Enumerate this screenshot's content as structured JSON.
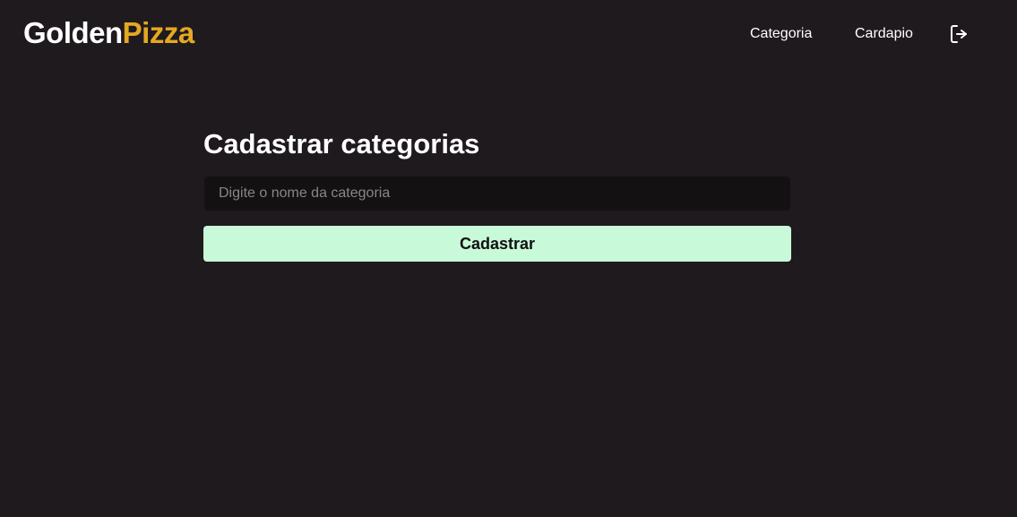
{
  "header": {
    "logo": {
      "part_1": "Golden",
      "part_2": "Pizza"
    },
    "nav": {
      "categoria": "Categoria",
      "cardapio": "Cardapio"
    },
    "logout_icon": "logout-icon"
  },
  "page": {
    "title": "Cadastrar categorias",
    "category_input": {
      "value": "",
      "placeholder": "Digite o nome da categoria"
    },
    "submit_label": "Cadastrar"
  },
  "colors": {
    "background": "#1f1a1d",
    "input_background": "#141113",
    "brand_accent": "#e5a823",
    "button_background": "#c8f9d8",
    "text": "#ffffff"
  }
}
